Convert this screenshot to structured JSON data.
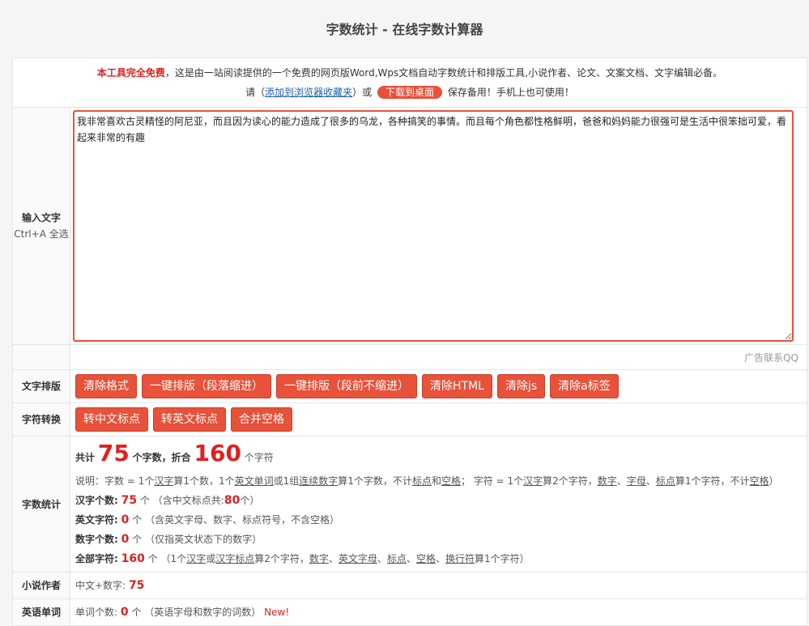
{
  "page_title": "字数统计 - 在线字数计算器",
  "notice": {
    "free_label": "本工具完全免费",
    "line1_rest": "，这是由一站阅读提供的一个免费的网页版Word,Wps文档自动字数统计和排版工具,小说作者、论文、文案文档、文字编辑必备。",
    "line2_prefix": "请（",
    "bookmark_link": "添加到浏览器收藏夹",
    "line2_mid": "）或",
    "download_button": "下载到桌面",
    "line2_suffix": "保存备用！手机上也可使用！"
  },
  "input_section": {
    "label": "输入文字",
    "hint": "Ctrl+A 全选",
    "text": "我非常喜欢古灵精怪的阿尼亚，而且因为读心的能力造成了很多的乌龙，各种搞笑的事情。而且每个角色都性格鲜明，爸爸和妈妈能力很强可是生活中很笨拙可爱，看起来非常的有趣"
  },
  "ad_text": "广告联系QQ",
  "layout_section": {
    "label": "文字排版",
    "buttons": [
      "清除格式",
      "一键排版（段落缩进）",
      "一键排版（段前不缩进）",
      "清除HTML",
      "清除js",
      "清除a标签"
    ]
  },
  "convert_section": {
    "label": "字符转换",
    "buttons": [
      "转中文标点",
      "转英文标点",
      "合并空格"
    ]
  },
  "stats_section": {
    "label": "字数统计",
    "total_prefix": "共计",
    "word_count": "75",
    "word_unit": "个字数，折合",
    "char_count": "160",
    "char_unit": "个字符",
    "explain": {
      "a": "说明：字数 = 1个",
      "b": "汉字",
      "c": "算1个数，1个",
      "d": "英文单词",
      "e": "或1组",
      "f": "连续数字",
      "g": "算1个字数，不计",
      "h": "标点",
      "i": "和",
      "j": "空格",
      "k": "；  字符 = 1个",
      "l": "汉字",
      "m": "算2个字符，",
      "n": "数字",
      "o": "、",
      "p": "字母",
      "q": "、",
      "r": "标点",
      "s": "算1个字符，不计",
      "t": "空格",
      "u": "）"
    },
    "hanzi_label": "汉字个数:",
    "hanzi_value": "75",
    "hanzi_unit": "个",
    "hanzi_note_prefix": "（含中文标点共:",
    "hanzi_punct": "80",
    "hanzi_note_suffix": "个）",
    "english_label": "英文字符:",
    "english_value": "0",
    "english_unit": "个",
    "english_note": "（含英文字母、数字、标点符号，不含空格）",
    "digit_label": "数字个数:",
    "digit_value": "0",
    "digit_unit": "个",
    "digit_note": "（仅指英文状态下的数字）",
    "all_label": "全部字符:",
    "all_value": "160",
    "all_unit": "个",
    "all_note": {
      "a": "（1个",
      "b": "汉字",
      "c": "或",
      "d": "汉字标点",
      "e": "算2个字符，",
      "f": "数字",
      "g": "、",
      "h": "英文字母",
      "i": "、",
      "j": "标点",
      "k": "、",
      "l": "空格",
      "m": "、",
      "n": "换行符",
      "o": "算1个字符）"
    }
  },
  "novel_section": {
    "label": "小说作者",
    "text": "中文+数字:",
    "value": "75"
  },
  "english_section": {
    "label": "英语单词",
    "text": "单词个数:",
    "value": "0",
    "unit": "个",
    "note": "（英语字母和数字的词数）",
    "new_badge": "New!"
  }
}
